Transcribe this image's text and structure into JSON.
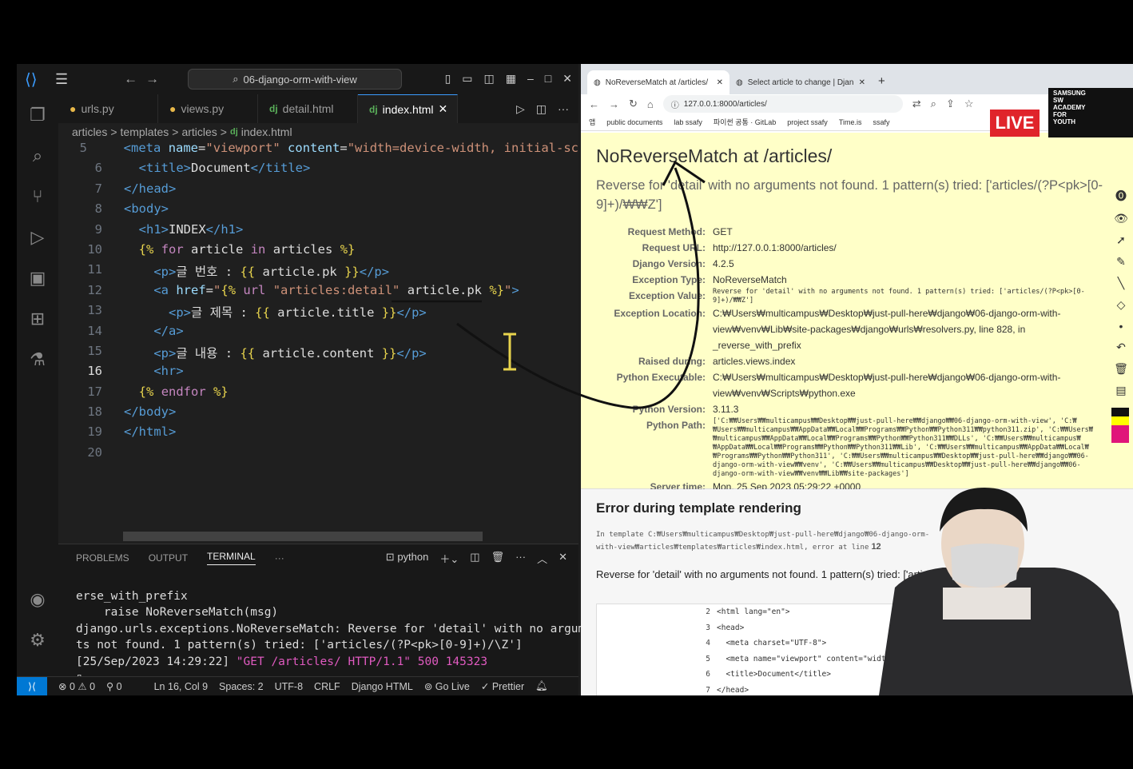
{
  "vscode": {
    "title": "06-django-orm-with-view",
    "tabs": [
      {
        "label": "urls.py",
        "icon": "python-icon"
      },
      {
        "label": "views.py",
        "icon": "python-icon"
      },
      {
        "label": "detail.html",
        "icon": "django-icon"
      },
      {
        "label": "index.html",
        "icon": "django-icon",
        "active": true
      }
    ],
    "breadcrumb": [
      "articles",
      "templates",
      "articles",
      "index.html"
    ],
    "code": [
      {
        "n": "5",
        "html": "  <span class='tag'>&lt;meta</span> <span class='attr'>name</span>=<span class='str'>\"viewport\"</span> <span class='attr'>content</span>=<span class='str'>\"width=device-width, initial-sc</span>"
      },
      {
        "n": "6",
        "html": "  <span class='tag'>&lt;title&gt;</span>Document<span class='tag'>&lt;/title&gt;</span>"
      },
      {
        "n": "7",
        "html": "<span class='tag'>&lt;/head&gt;</span>"
      },
      {
        "n": "8",
        "html": "<span class='tag'>&lt;body&gt;</span>"
      },
      {
        "n": "9",
        "html": "  <span class='tag'>&lt;h1&gt;</span>INDEX<span class='tag'>&lt;/h1&gt;</span>"
      },
      {
        "n": "10",
        "html": "  <span class='tmpl'>{%</span> <span class='kw'>for</span> article <span class='kw'>in</span> articles <span class='tmpl'>%}</span>"
      },
      {
        "n": "11",
        "html": "    <span class='tag'>&lt;p&gt;</span>글 번호 : <span class='tmpl'>{{</span> article.pk <span class='tmpl'>}}</span><span class='tag'>&lt;/p&gt;</span>"
      },
      {
        "n": "12",
        "html": "    <span class='tag'>&lt;a</span> <span class='attr'>href</span>=<span class='str'>\"</span><span class='tmpl'>{%</span> <span class='kw'>url</span> <span class='str'>\"articles:detail\"</span> article.pk <span class='tmpl'>%}</span><span class='str'>\"</span><span class='tag'>&gt;</span>"
      },
      {
        "n": "13",
        "html": "      <span class='tag'>&lt;p&gt;</span>글 제목 : <span class='tmpl'>{{</span> article.title <span class='tmpl'>}}</span><span class='tag'>&lt;/p&gt;</span>"
      },
      {
        "n": "14",
        "html": "    <span class='tag'>&lt;/a&gt;</span>"
      },
      {
        "n": "15",
        "html": "    <span class='tag'>&lt;p&gt;</span>글 내용 : <span class='tmpl'>{{</span> article.content <span class='tmpl'>}}</span><span class='tag'>&lt;/p&gt;</span>"
      },
      {
        "n": "16",
        "html": "    <span class='tag'>&lt;hr&gt;</span>",
        "current": true
      },
      {
        "n": "17",
        "html": "  <span class='tmpl'>{%</span> <span class='kw'>endfor</span> <span class='tmpl'>%}</span>"
      },
      {
        "n": "18",
        "html": "<span class='tag'>&lt;/body&gt;</span>"
      },
      {
        "n": "19",
        "html": "<span class='tag'>&lt;/html&gt;</span>"
      },
      {
        "n": "20",
        "html": ""
      }
    ],
    "panel": {
      "tabs": [
        "PROBLEMS",
        "OUTPUT",
        "TERMINAL"
      ],
      "active_tab": "TERMINAL",
      "shell": "python",
      "lines": [
        "erse_with_prefix",
        "    raise NoReverseMatch(msg)",
        "django.urls.exceptions.NoReverseMatch: Reverse for 'detail' with no argumen",
        "ts not found. 1 pattern(s) tried: ['articles/(?P<pk>[0-9]+)/\\Z']"
      ],
      "log_prefix": "[25/Sep/2023 14:29:22] ",
      "log_get": "\"GET /articles/ HTTP/1.1\" 500 145323"
    },
    "status": {
      "errors": "0",
      "warnings": "0",
      "ports": "0",
      "position": "Ln 16, Col 9",
      "spaces": "Spaces: 2",
      "encoding": "UTF-8",
      "eol": "CRLF",
      "language": "Django HTML",
      "golive": "Go Live",
      "prettier": "Prettier"
    }
  },
  "browser": {
    "tabs": [
      {
        "label": "NoReverseMatch at /articles/",
        "active": true
      },
      {
        "label": "Select article to change | Djan",
        "active": false
      }
    ],
    "url": "127.0.0.1:8000/articles/",
    "bookmarks": [
      "앱",
      "public documents",
      "lab ssafy",
      "파이썬 공통 · GitLab",
      "project ssafy",
      "Time.is",
      "ssafy"
    ],
    "live_badge": "LIVE",
    "samsung_logo": [
      "SAMSUNG",
      "SW",
      "ACADEMY",
      "FOR",
      "YOUTH"
    ],
    "error_title": "NoReverseMatch at /articles/",
    "error_message": "Reverse for 'detail' with no arguments not found. 1 pattern(s) tried: ['articles/(?P<pk>[0-9]+)/₩₩Z']",
    "meta": [
      {
        "k": "Request Method:",
        "v": "GET"
      },
      {
        "k": "Request URL:",
        "v": "http://127.0.0.1:8000/articles/"
      },
      {
        "k": "Django Version:",
        "v": "4.2.5"
      },
      {
        "k": "Exception Type:",
        "v": "NoReverseMatch"
      },
      {
        "k": "Exception Value:",
        "v": "Reverse for 'detail' with no arguments not found. 1 pattern(s) tried: ['articles/(?P<pk>[0-9]+)/₩₩Z']",
        "mono": true
      },
      {
        "k": "Exception Location:",
        "v": "C:₩Users₩multicampus₩Desktop₩just-pull-here₩django₩06-django-orm-with-view₩venv₩Lib₩site-packages₩django₩urls₩resolvers.py, line 828, in _reverse_with_prefix"
      },
      {
        "k": "Raised during:",
        "v": "articles.views.index"
      },
      {
        "k": "Python Executable:",
        "v": "C:₩Users₩multicampus₩Desktop₩just-pull-here₩django₩06-django-orm-with-view₩venv₩Scripts₩python.exe"
      },
      {
        "k": "Python Version:",
        "v": "3.11.3"
      },
      {
        "k": "Python Path:",
        "v": "['C:₩₩Users₩₩multicampus₩₩Desktop₩₩just-pull-here₩₩django₩₩06-django-orm-with-view', 'C:₩₩Users₩₩multicampus₩₩AppData₩₩Local₩₩Programs₩₩Python₩₩Python311₩₩python311.zip', 'C:₩₩Users₩₩multicampus₩₩AppData₩₩Local₩₩Programs₩₩Python₩₩Python311₩₩DLLs', 'C:₩₩Users₩₩multicampus₩₩AppData₩₩Local₩₩Programs₩₩Python₩₩Python311₩₩Lib', 'C:₩₩Users₩₩multicampus₩₩AppData₩₩Local₩₩Programs₩₩Python₩₩Python311', 'C:₩₩Users₩₩multicampus₩₩Desktop₩₩just-pull-here₩₩django₩₩06-django-orm-with-view₩₩venv', 'C:₩₩Users₩₩multicampus₩₩Desktop₩₩just-pull-here₩₩django₩₩06-django-orm-with-view₩₩venv₩₩Lib₩₩site-packages']",
        "mono": true
      },
      {
        "k": "Server time:",
        "v": "Mon, 25 Sep 2023 05:29:22 +0000"
      }
    ],
    "template_heading": "Error during template rendering",
    "template_intro": "In template C:₩Users₩multicampus₩Desktop₩just-pull-here₩django₩06-django-orm-with-view₩articles₩templates₩articles₩index.html, error at line",
    "template_line": "12",
    "template_reason": "Reverse for 'detail' with no arguments not found. 1 pattern(s) tried: ['articles/(?P<pk>[0-9]+)/₩₩Z']",
    "source_lines": [
      {
        "n": "2",
        "t": "<html lang=\"en\">"
      },
      {
        "n": "3",
        "t": "<head>"
      },
      {
        "n": "4",
        "t": "  <meta charset=\"UTF-8\">"
      },
      {
        "n": "5",
        "t": "  <meta name=\"viewport\" content=\"width=device-width, initial-scale=1.0\">"
      },
      {
        "n": "6",
        "t": "  <title>Document</title>"
      },
      {
        "n": "7",
        "t": "</head>"
      }
    ]
  },
  "colors": {
    "accent": "#0078d4",
    "error_bg": "#ffffc8",
    "live_red": "#e0242b"
  }
}
